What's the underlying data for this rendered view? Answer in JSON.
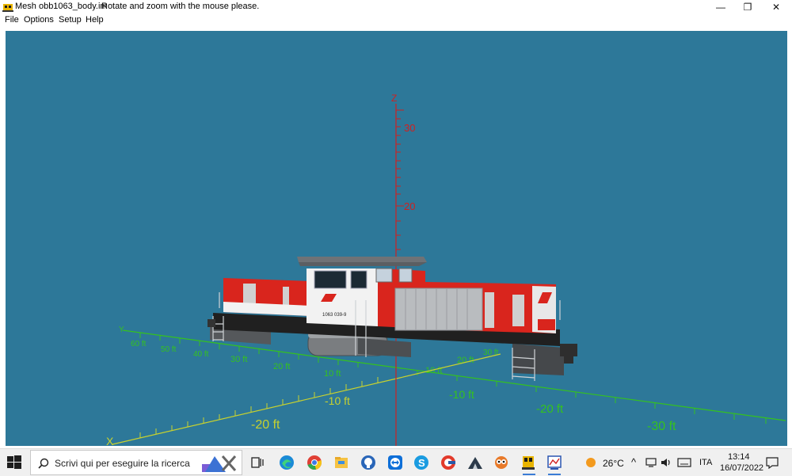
{
  "window": {
    "title": "Mesh obb1063_body.im",
    "hint": "Rotate and zoom with the mouse please.",
    "minimize": "—",
    "restore": "❐",
    "close": "✕"
  },
  "menu": [
    "File",
    "Options",
    "Setup",
    "Help"
  ],
  "axes": {
    "z_label": "Z",
    "y_label": "Y",
    "x_label": "X",
    "z_ticks": [
      "30",
      "20"
    ],
    "y_ticks": [
      "60 ft",
      "50 ft",
      "40 ft",
      "30 ft",
      "20 ft",
      "10 ft",
      "10 ft",
      "20 ft",
      "30 ft"
    ],
    "x_ticks": [
      "-10 ft",
      "-20 ft",
      "-10 ft",
      "-20 ft",
      "-30 ft"
    ]
  },
  "locomotive": {
    "number_plate": "1063 039-9"
  },
  "colors": {
    "viewport_bg": "#2d7899",
    "loco_red": "#d9251d",
    "loco_white": "#f2f2f2",
    "axis_green": "#35c21e",
    "axis_yellow": "#c8d22e",
    "axis_red": "#d02020"
  },
  "taskbar": {
    "search_placeholder": "Scrivi qui per eseguire la ricerca",
    "weather": "26°C",
    "language": "ITA",
    "time": "13:14",
    "date": "16/07/2022",
    "icons": [
      "task-view-icon",
      "edge-icon",
      "chrome-icon",
      "file-explorer-icon",
      "github-icon",
      "teamviewer-icon",
      "skype-icon",
      "autoit-icon",
      "mountain-app-icon",
      "owl-icon",
      "train-app-icon",
      "mesh-viewer-icon"
    ]
  }
}
